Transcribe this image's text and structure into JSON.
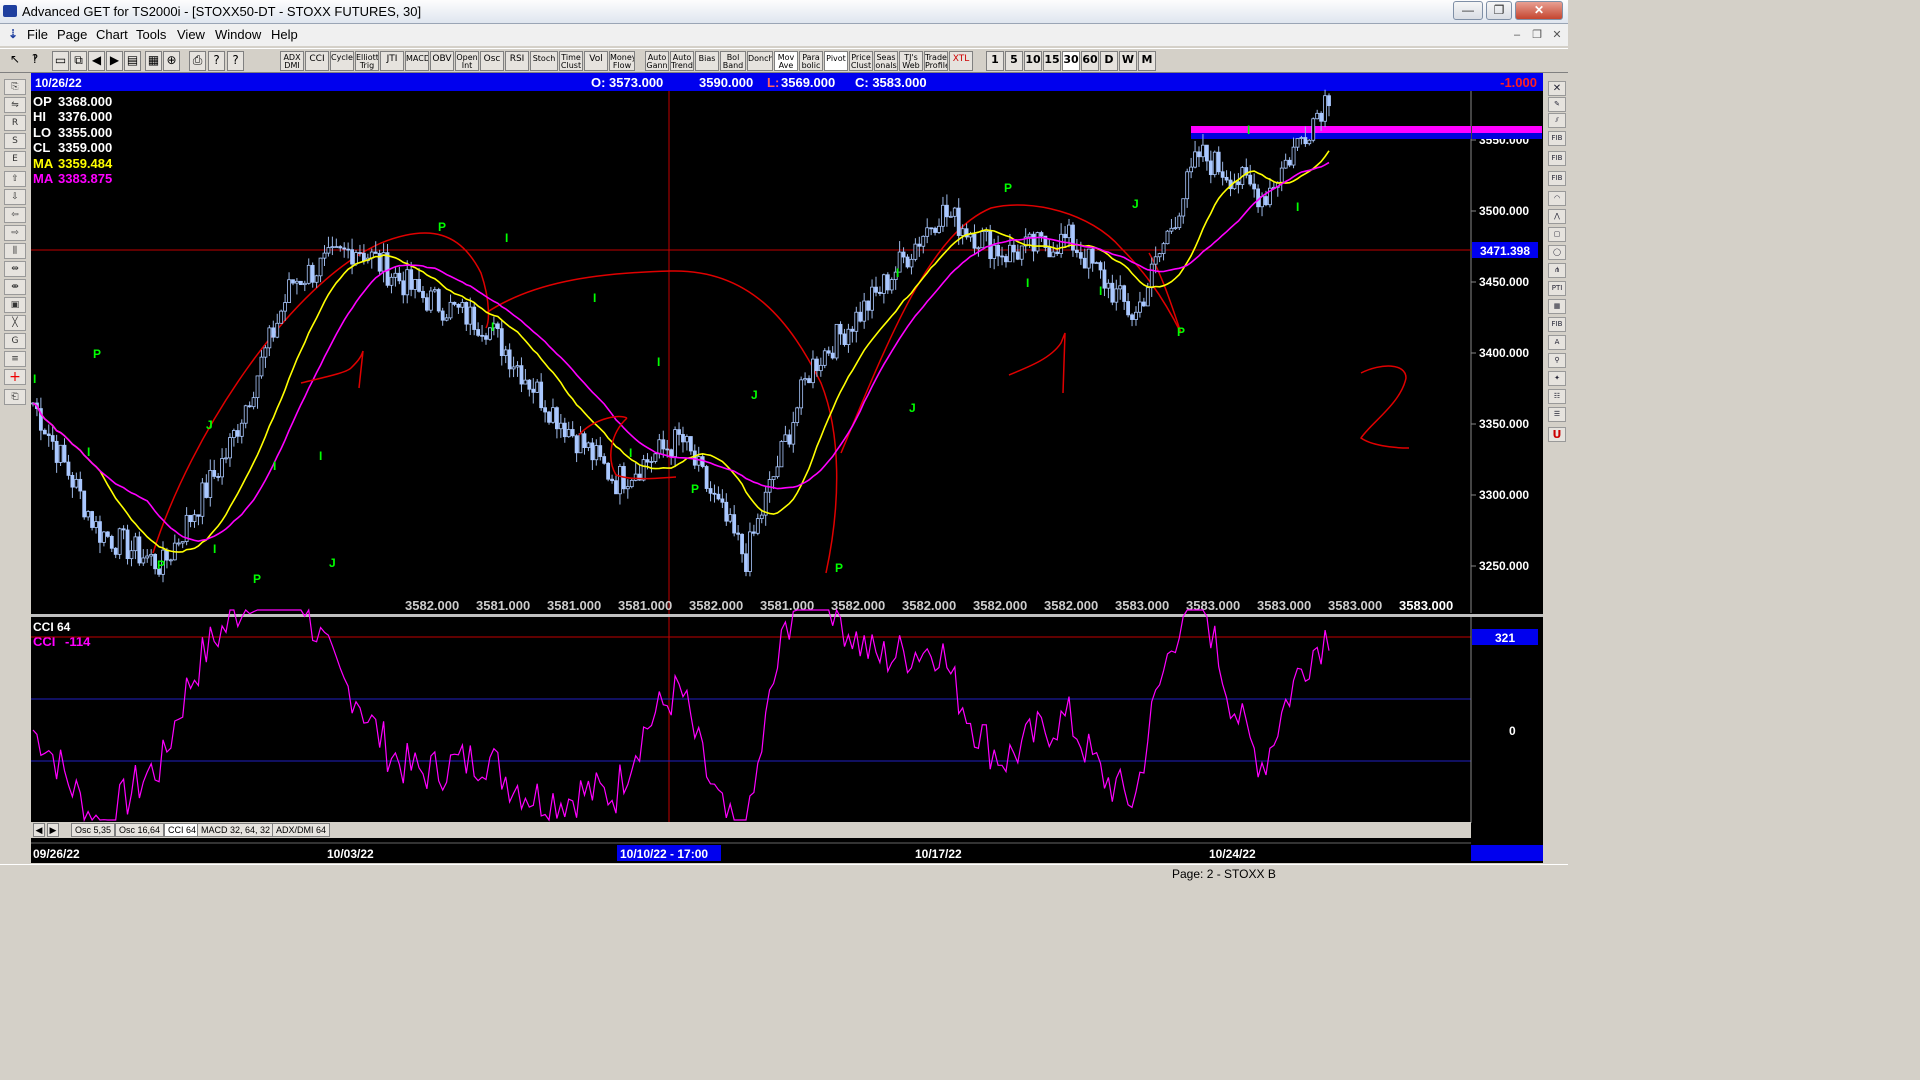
{
  "window": {
    "title": "Advanced GET for TS2000i - [STOXX50-DT - STOXX FUTURES, 30]",
    "minimize": "—",
    "maximize": "❐",
    "close": "✕"
  },
  "menu": {
    "items": [
      {
        "label": "File"
      },
      {
        "label": "Page"
      },
      {
        "label": "Chart"
      },
      {
        "label": "Tools"
      },
      {
        "label": "View"
      },
      {
        "label": "Window"
      },
      {
        "label": "Help"
      }
    ]
  },
  "toolbar": {
    "left_icons": [
      "arrow-icon",
      "help-pointer-icon",
      "new-page-icon",
      "copy-icon",
      "back-icon",
      "forward-icon",
      "layers-icon",
      "grid-icon",
      "target-icon",
      "print-icon",
      "info-icon",
      "help-icon"
    ],
    "studies": [
      "ADX DMI",
      "CCI",
      "Cycles",
      "Elliott Trig",
      "JTI",
      "MACD",
      "OBV",
      "Open Int",
      "Osc",
      "RSI",
      "Stoch",
      "Time Clust",
      "Vol",
      "Money Flow",
      "Auto Gann",
      "Auto Trend",
      "Bias",
      "Bol Band",
      "Donch",
      "Mov Ave",
      "Para bolic",
      "Pivot",
      "Price Clust",
      "Seas onals",
      "TJ's Web",
      "Trade Profile",
      "XTL"
    ],
    "timeframes": [
      "1",
      "5",
      "10",
      "15",
      "30",
      "60",
      "D",
      "W",
      "M"
    ],
    "active_timeframe": "30"
  },
  "header": {
    "date": "10/26/22",
    "open": "O: 3573.000",
    "high": "3590.000",
    "low": "L:  3569.000",
    "close": "C:  3583.000",
    "change": "-1.000"
  },
  "legend": {
    "op_label": "OP",
    "op": "3368.000",
    "hi_label": "HI",
    "hi": "3376.000",
    "lo_label": "LO",
    "lo": "3355.000",
    "cl_label": "CL",
    "cl": "3359.000",
    "ma1_label": "MA",
    "ma1": "3359.484",
    "ma2_label": "MA",
    "ma2": "3383.875"
  },
  "price_axis": {
    "ticks": [
      "3550.000",
      "3500.000",
      "3450.000",
      "3400.000",
      "3350.000",
      "3300.000",
      "3250.000"
    ],
    "crosshair_value": "3471.398"
  },
  "price_row": [
    "3582.000",
    "3581.000",
    "3581.000",
    "3581.000",
    "3582.000",
    "3581.000",
    "3582.000",
    "3582.000",
    "3582.000",
    "3582.000",
    "3583.000",
    "3583.000",
    "3583.000",
    "3583.000",
    "3583.000"
  ],
  "cci_panel": {
    "title": "CCI 64",
    "value_label": "CCI",
    "value": "-114",
    "badge": "321",
    "zero_label": "0"
  },
  "tabs": [
    "Osc 5,35",
    "Osc 16,64",
    "CCI 64",
    "MACD 32, 64, 32",
    "ADX/DMI 64"
  ],
  "active_tab": "CCI 64",
  "date_axis": {
    "labels": [
      "09/26/22",
      "10/03/22",
      "10/10/22 - 17:00",
      "10/17/22",
      "10/24/22"
    ],
    "highlight": "10/10/22 - 17:00"
  },
  "markers": {
    "p": "P",
    "i": "I",
    "j": "J"
  },
  "annotations": {
    "wave_one": "1",
    "wave_two": "2"
  },
  "status": {
    "page": "Page: 2 - STOXX B"
  },
  "colors": {
    "background": "#000000",
    "bars": "#aac8ff",
    "ma_fast": "#ffff00",
    "ma_slow": "#ff00ff",
    "arcs": "#ff0000",
    "markers": "#00ff00",
    "axis_badge": "#0000ff",
    "change_text": "#ff0000"
  },
  "chart_data": {
    "type": "candlestick",
    "title": "STOXX50-DT - STOXX FUTURES, 30",
    "ylim": [
      3230,
      3600
    ],
    "approx_closes": [
      {
        "x": "09/26/22",
        "y": 3365
      },
      {
        "x": "09/29/22",
        "y": 3275
      },
      {
        "x": "09/30/22",
        "y": 3250
      },
      {
        "x": "10/03/22",
        "y": 3330
      },
      {
        "x": "10/04/22",
        "y": 3450
      },
      {
        "x": "10/05/22",
        "y": 3475
      },
      {
        "x": "10/06/22",
        "y": 3440
      },
      {
        "x": "10/07/22",
        "y": 3420
      },
      {
        "x": "10/10/22",
        "y": 3360
      },
      {
        "x": "10/11/22",
        "y": 3310
      },
      {
        "x": "10/12/22",
        "y": 3340
      },
      {
        "x": "10/13/22",
        "y": 3255
      },
      {
        "x": "10/14/22",
        "y": 3390
      },
      {
        "x": "10/17/22",
        "y": 3440
      },
      {
        "x": "10/18/22",
        "y": 3500
      },
      {
        "x": "10/19/22",
        "y": 3470
      },
      {
        "x": "10/20/22",
        "y": 3480
      },
      {
        "x": "10/21/22",
        "y": 3425
      },
      {
        "x": "10/24/22",
        "y": 3540
      },
      {
        "x": "10/25/22",
        "y": 3510
      },
      {
        "x": "10/26/22",
        "y": 3583
      }
    ]
  }
}
